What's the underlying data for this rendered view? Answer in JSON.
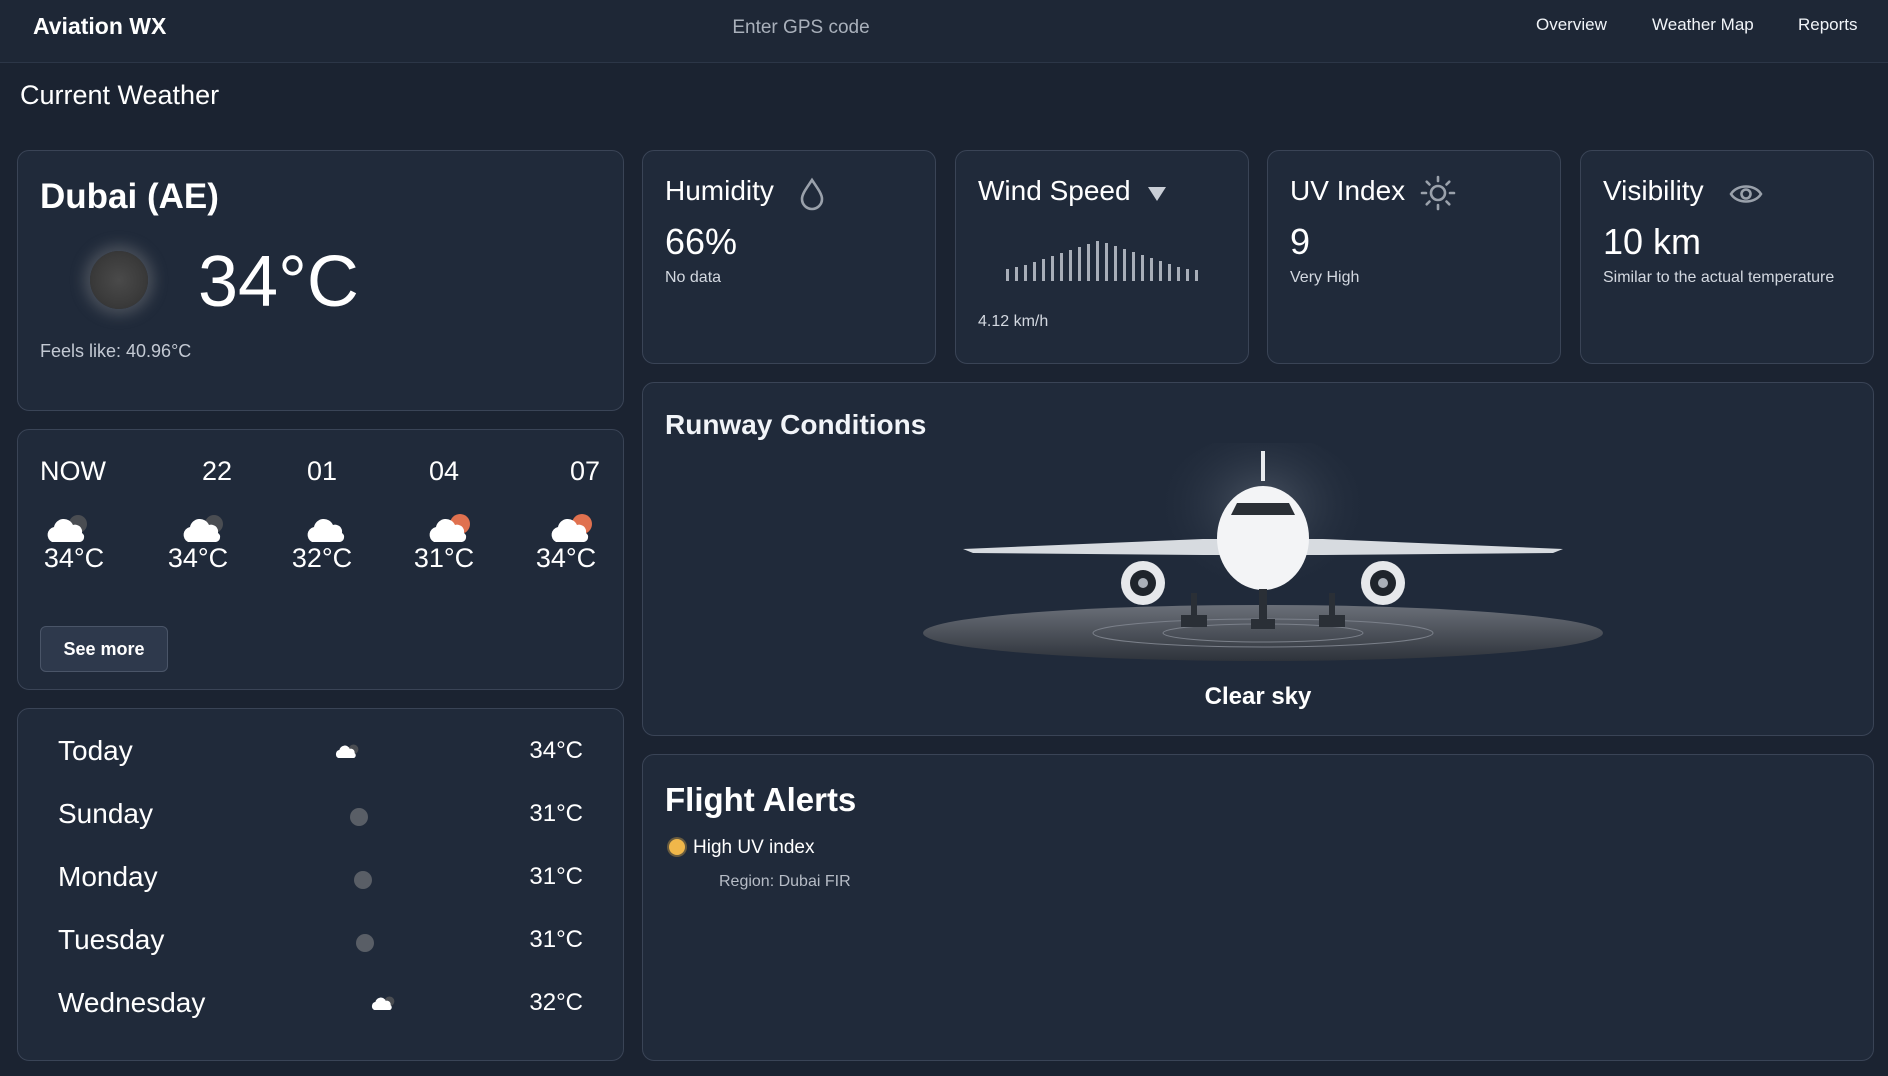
{
  "header": {
    "brand": "Aviation WX",
    "search_placeholder": "Enter GPS code",
    "nav": [
      "Overview",
      "Weather Map",
      "Reports"
    ]
  },
  "page_title": "Current Weather",
  "current": {
    "city": "Dubai (AE)",
    "temperature": "34°C",
    "feels_like": "Feels like: 40.96°C",
    "icon": "dark-sun-icon"
  },
  "hourly": {
    "items": [
      {
        "time": "NOW",
        "temp": "34°C",
        "icon": "cloud-moon-icon"
      },
      {
        "time": "22",
        "temp": "34°C",
        "icon": "cloud-moon-icon"
      },
      {
        "time": "01",
        "temp": "32°C",
        "icon": "cloud-icon"
      },
      {
        "time": "04",
        "temp": "31°C",
        "icon": "cloud-sun-icon"
      },
      {
        "time": "07",
        "temp": "34°C",
        "icon": "cloud-sun-icon"
      }
    ],
    "see_more": "See more"
  },
  "daily": [
    {
      "day": "Today",
      "temp": "34°C",
      "icon": "cloud-icon"
    },
    {
      "day": "Sunday",
      "temp": "31°C",
      "icon": "dot-icon"
    },
    {
      "day": "Monday",
      "temp": "31°C",
      "icon": "dot-icon"
    },
    {
      "day": "Tuesday",
      "temp": "31°C",
      "icon": "dot-icon"
    },
    {
      "day": "Wednesday",
      "temp": "32°C",
      "icon": "cloud-icon"
    }
  ],
  "stats": {
    "humidity": {
      "title": "Humidity",
      "value": "66%",
      "sub": "No data",
      "icon": "droplet-icon"
    },
    "wind": {
      "title": "Wind Speed",
      "sub": "4.12 km/h",
      "icon": "triangle-down-icon"
    },
    "uv": {
      "title": "UV Index",
      "value": "9",
      "sub": "Very High",
      "icon": "sun-icon"
    },
    "visibility": {
      "title": "Visibility",
      "value": "10 km",
      "sub": "Similar to the actual temperature",
      "icon": "eye-icon"
    }
  },
  "runway": {
    "title": "Runway Conditions",
    "caption": "Clear sky"
  },
  "alerts": {
    "title": "Flight Alerts",
    "items": [
      {
        "label": "High UV index",
        "region": "Region: Dubai FIR",
        "icon": "sun-badge-icon"
      }
    ]
  },
  "colors": {
    "background": "#1b2331",
    "card": "#202a3a",
    "card_border": "#3a4456",
    "sun_accent": "#e0714f",
    "alert_badge": "#f0b74a"
  }
}
